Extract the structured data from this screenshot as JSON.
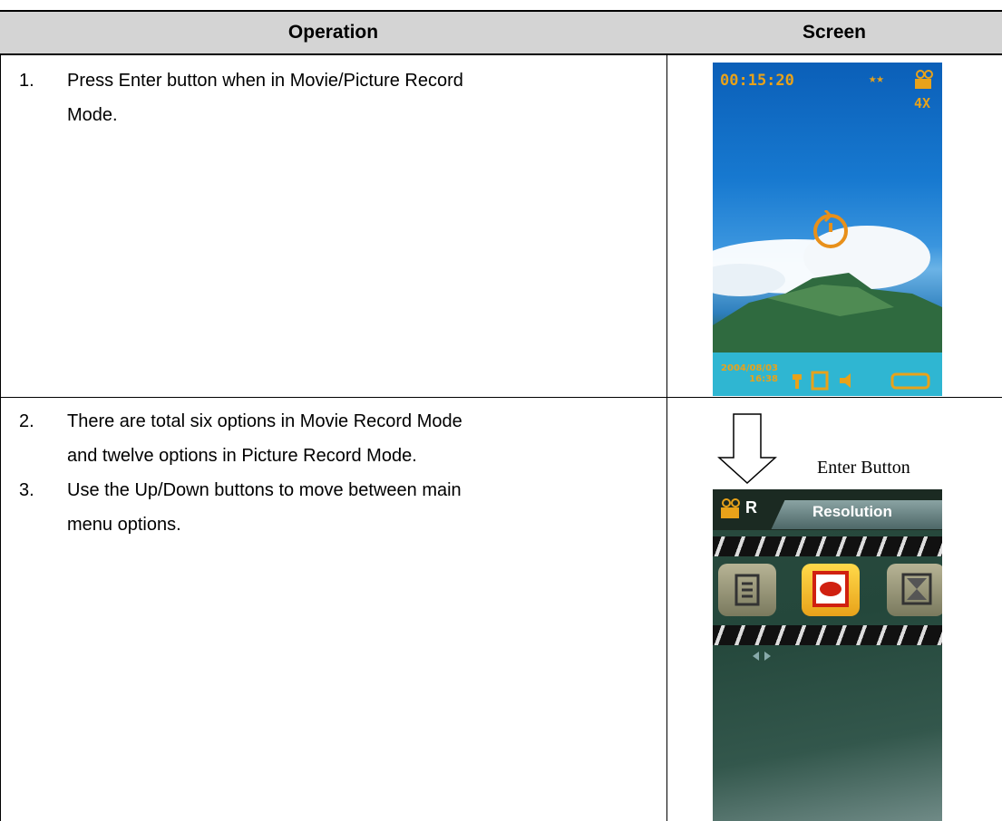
{
  "table": {
    "headers": {
      "operation": "Operation",
      "screen": "Screen"
    },
    "rows": [
      {
        "steps": [
          {
            "num": "1.",
            "lines": [
              "Press Enter button when in Movie/Picture Record",
              "Mode."
            ]
          }
        ],
        "screen": {
          "time": "00:15:20",
          "quality": "★★",
          "zoom": "4X",
          "date": "2004/08/03",
          "clock": "16:38",
          "accent_color": "#e8a21a"
        }
      },
      {
        "steps": [
          {
            "num": "2.",
            "lines": [
              "There are total six options in Movie Record Mode",
              "and twelve options in Picture Record Mode."
            ]
          },
          {
            "num": "3.",
            "lines": [
              "Use the Up/Down buttons to move between main",
              "menu options."
            ]
          }
        ],
        "screen": {
          "arrow_label": "Enter Button",
          "mode_letter": "R",
          "menu_title": "Resolution"
        }
      }
    ]
  }
}
